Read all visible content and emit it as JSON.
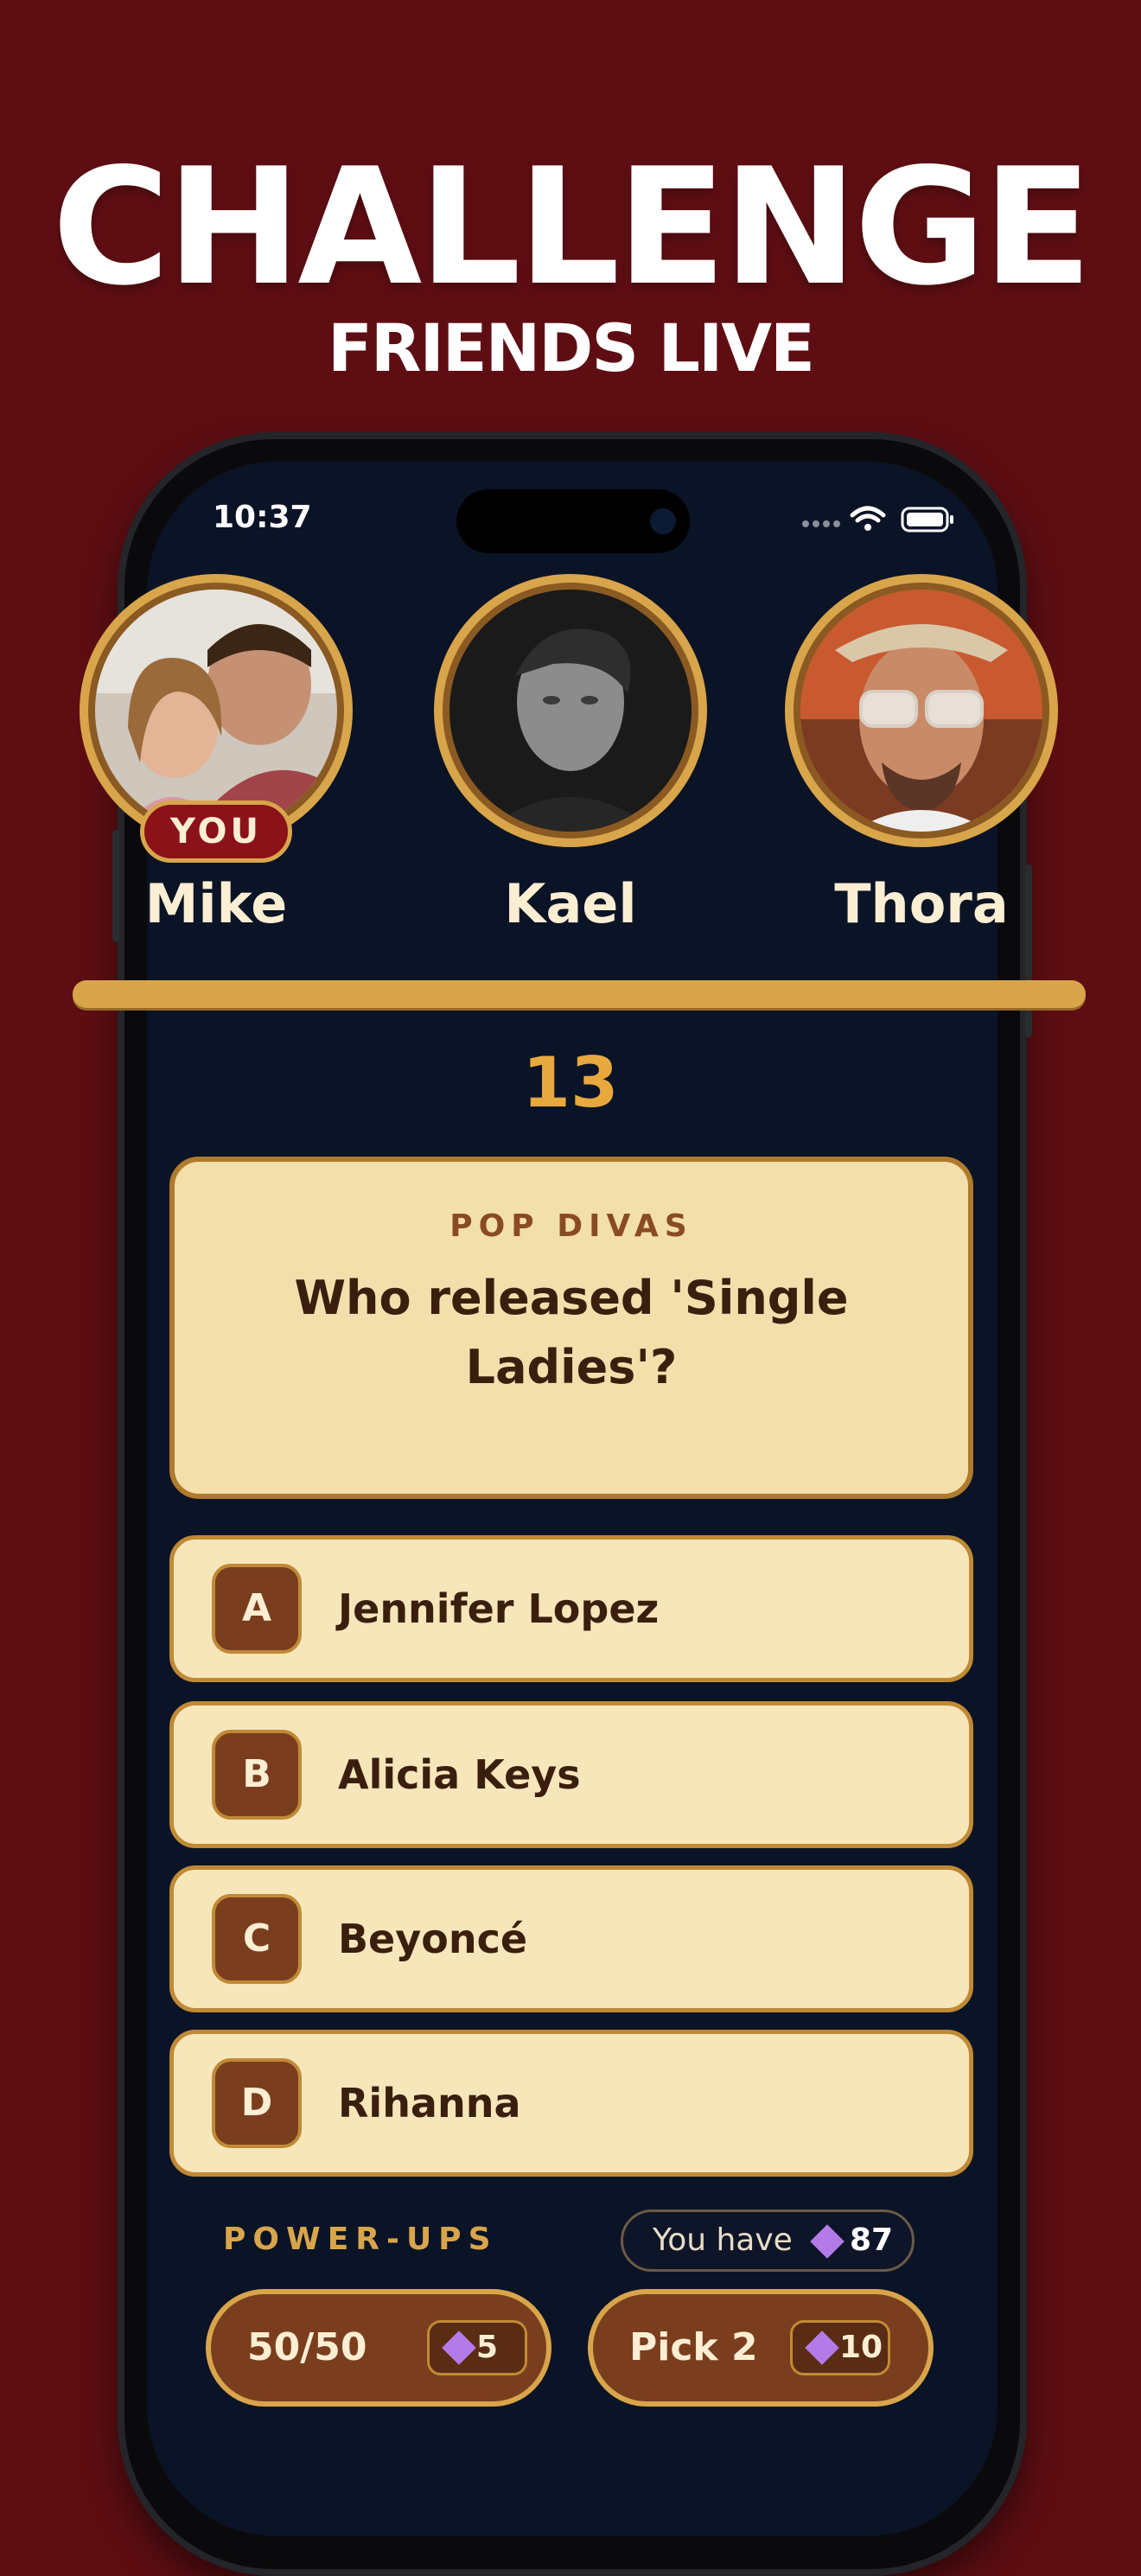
{
  "headline": "CHALLENGE",
  "subheadline": "FRIENDS LIVE",
  "status_bar": {
    "time": "10:37"
  },
  "players": [
    {
      "name": "Mike",
      "badge": "YOU"
    },
    {
      "name": "Kael"
    },
    {
      "name": "Thora"
    }
  ],
  "timer": "13",
  "question": {
    "category": "POP DIVAS",
    "text": "Who released 'Single Ladies'?"
  },
  "answers": [
    {
      "letter": "A",
      "text": "Jennifer Lopez"
    },
    {
      "letter": "B",
      "text": "Alicia Keys"
    },
    {
      "letter": "C",
      "text": "Beyoncé"
    },
    {
      "letter": "D",
      "text": "Rihanna"
    }
  ],
  "powerups": {
    "label": "POWER-UPS",
    "balance_label": "You have",
    "balance_value": "87",
    "items": [
      {
        "label": "50/50",
        "cost": "5"
      },
      {
        "label": "Pick 2",
        "cost": "10"
      }
    ]
  },
  "colors": {
    "background": "#5e0e13",
    "gold": "#d9a54b",
    "card": "#f3dfab",
    "brown": "#7a3e1f",
    "gem": "#b47be8"
  }
}
